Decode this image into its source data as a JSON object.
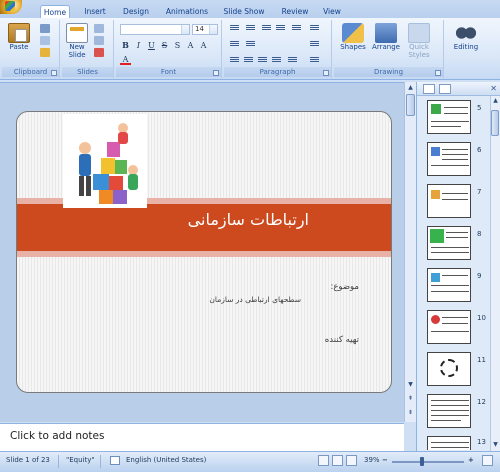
{
  "tabs": [
    "Home",
    "Insert",
    "Design",
    "Animations",
    "Slide Show",
    "Review",
    "View"
  ],
  "ribbon": {
    "clipboard": {
      "label": "Clipboard",
      "paste": "Paste"
    },
    "slides": {
      "label": "Slides",
      "new_slide_line1": "New",
      "new_slide_line2": "Slide"
    },
    "font": {
      "label": "Font",
      "size_value": "14"
    },
    "paragraph": {
      "label": "Paragraph"
    },
    "drawing": {
      "label": "Drawing",
      "shapes": "Shapes",
      "arrange": "Arrange",
      "quick_styles_line1": "Quick",
      "quick_styles_line2": "Styles"
    },
    "editing": {
      "label": "Editing"
    }
  },
  "slide": {
    "title": "ارتباطات سازمانی",
    "subject_label": "موضوع:",
    "subject_value": "سطحهای ارتباطی در سازمان",
    "prepared_label": "تهیه کننده"
  },
  "notes": {
    "placeholder": "Click to add notes"
  },
  "thumbnails": {
    "numbers": [
      "5",
      "6",
      "7",
      "8",
      "9",
      "10",
      "11",
      "12",
      "13"
    ]
  },
  "status": {
    "slide_info": "Slide 1 of 23",
    "theme": "\"Equity\"",
    "language": "English (United States)",
    "zoom": "39%"
  },
  "colors": {
    "band": "#cc4a1d",
    "ribbon": "#dbe8f8"
  }
}
